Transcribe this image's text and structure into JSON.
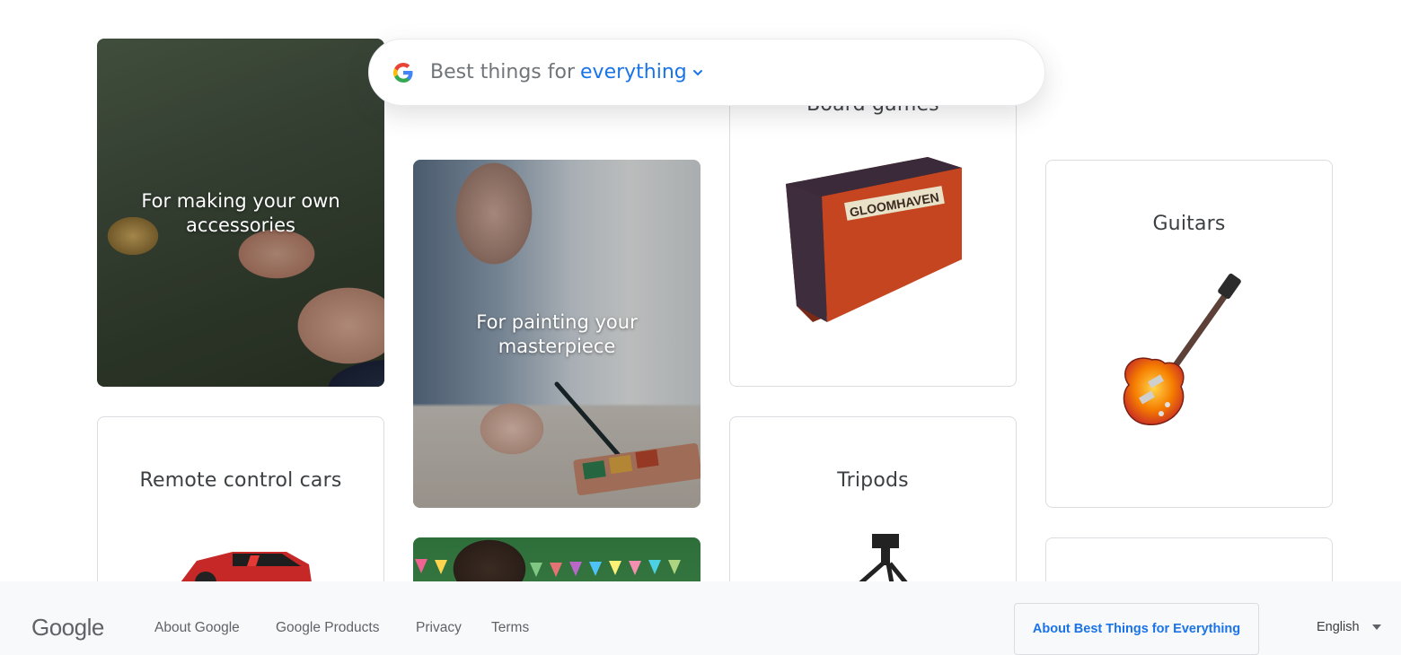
{
  "search": {
    "prefix": "Best things for",
    "selected": "everything",
    "logo_icon": "google-g-icon"
  },
  "cards": {
    "jewelry": {
      "title": "For making your own accessories"
    },
    "painting": {
      "title": "For painting your masterpiece"
    },
    "board_games": {
      "title": "Board games",
      "product": "GLOOMHAVEN"
    },
    "guitars": {
      "title": "Guitars"
    },
    "rc_cars": {
      "title": "Remote control cars"
    },
    "tripods": {
      "title": "Tripods"
    }
  },
  "footer": {
    "logo": "Google",
    "links": [
      "About Google",
      "Google Products",
      "Privacy",
      "Terms"
    ],
    "about_button": "About Best Things for Everything",
    "language": "English"
  },
  "colors": {
    "accent": "#1a73e8",
    "footer_bg": "#f8f9fa",
    "border": "#dadce0"
  }
}
